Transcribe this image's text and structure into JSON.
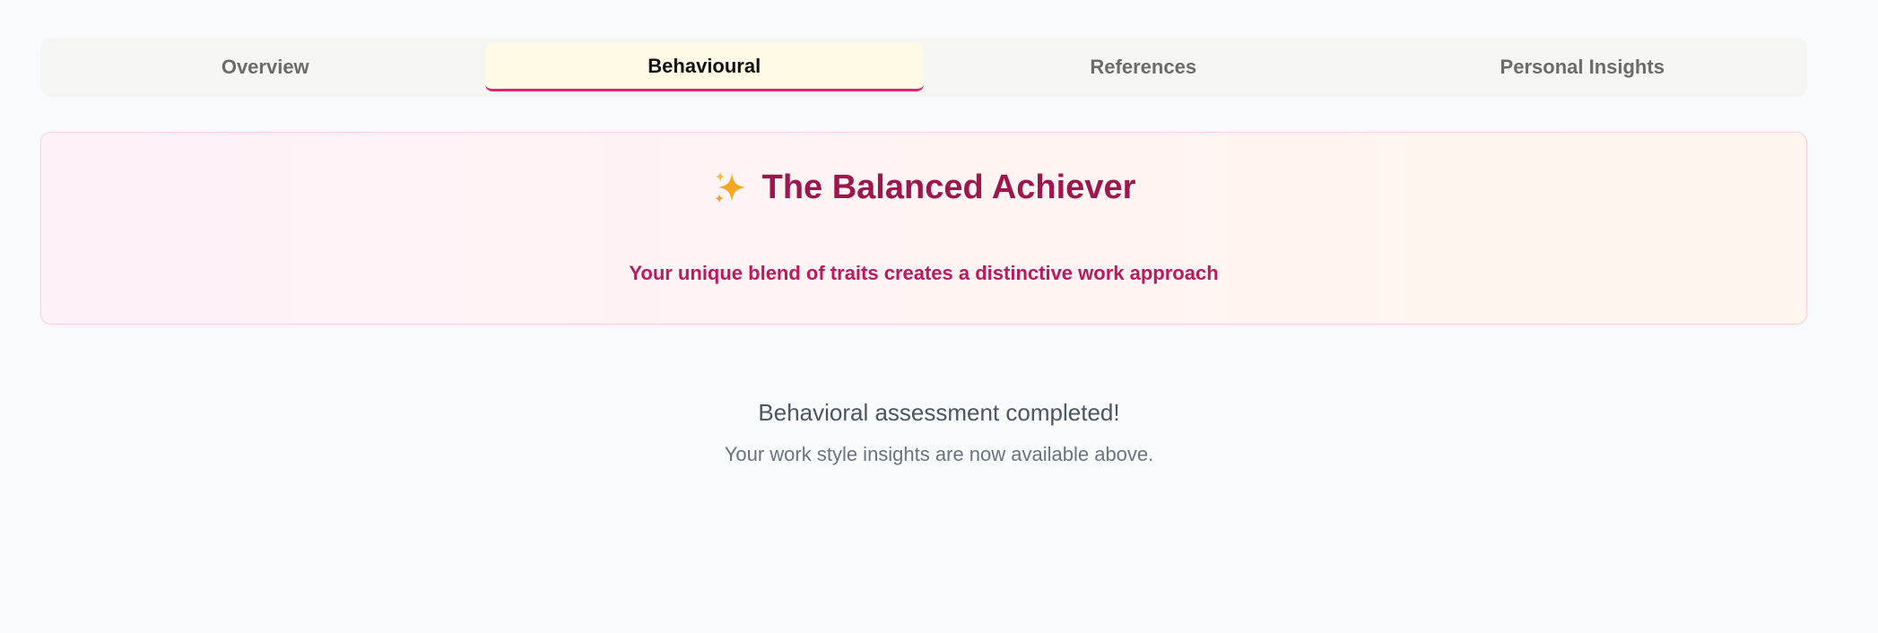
{
  "tabs": [
    {
      "label": "Overview",
      "active": false
    },
    {
      "label": "Behavioural",
      "active": true
    },
    {
      "label": "References",
      "active": false
    },
    {
      "label": "Personal Insights",
      "active": false
    }
  ],
  "hero": {
    "icon": "sparkles-icon",
    "title": "The Balanced Achiever",
    "subtitle": "Your unique blend of traits creates a distinctive work approach"
  },
  "status": {
    "message": "Behavioral assessment completed!",
    "detail": "Your work style insights are now available above."
  },
  "colors": {
    "accent": "#db2777",
    "title": "#9d174d",
    "subtitle": "#be185d",
    "active_tab_bg": "#fefae6"
  }
}
